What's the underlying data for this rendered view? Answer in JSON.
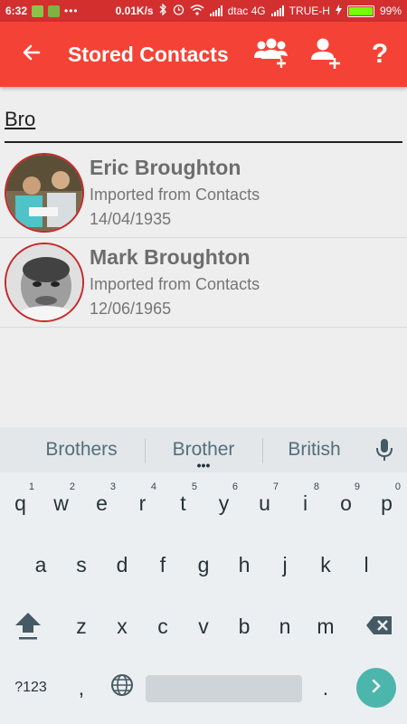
{
  "status_bar": {
    "time": "6:32",
    "speed": "0.01K/s",
    "carrier1": "dtac 4G",
    "carrier2": "TRUE-H",
    "battery": "99%",
    "battery_level": 0.99,
    "dots": "•••"
  },
  "app_bar": {
    "title": "Stored Contacts",
    "back_icon": "arrow-left-icon",
    "actions": [
      "group-add-icon",
      "person-add-icon",
      "help-icon"
    ],
    "help_label": "?"
  },
  "search": {
    "value": "Bro"
  },
  "contacts": [
    {
      "name": "Eric Broughton",
      "source": "Imported from Contacts",
      "date": "14/04/1935"
    },
    {
      "name": "Mark Broughton",
      "source": "Imported from Contacts",
      "date": "12/06/1965"
    }
  ],
  "keyboard": {
    "suggestions": [
      "Brothers",
      "Brother",
      "British"
    ],
    "more_indicator": "•••",
    "row1": [
      "q",
      "w",
      "e",
      "r",
      "t",
      "y",
      "u",
      "i",
      "o",
      "p"
    ],
    "row1_hints": [
      "1",
      "2",
      "3",
      "4",
      "5",
      "6",
      "7",
      "8",
      "9",
      "0"
    ],
    "row2": [
      "a",
      "s",
      "d",
      "f",
      "g",
      "h",
      "j",
      "k",
      "l"
    ],
    "row3": [
      "z",
      "x",
      "c",
      "v",
      "b",
      "n",
      "m"
    ],
    "symbols_key": "?123",
    "comma_key": ",",
    "period_key": "."
  },
  "colors": {
    "status_bar": "#d32f2f",
    "app_bar": "#f44336",
    "avatar_border": "#c62828",
    "enter_key": "#4db6ac"
  }
}
